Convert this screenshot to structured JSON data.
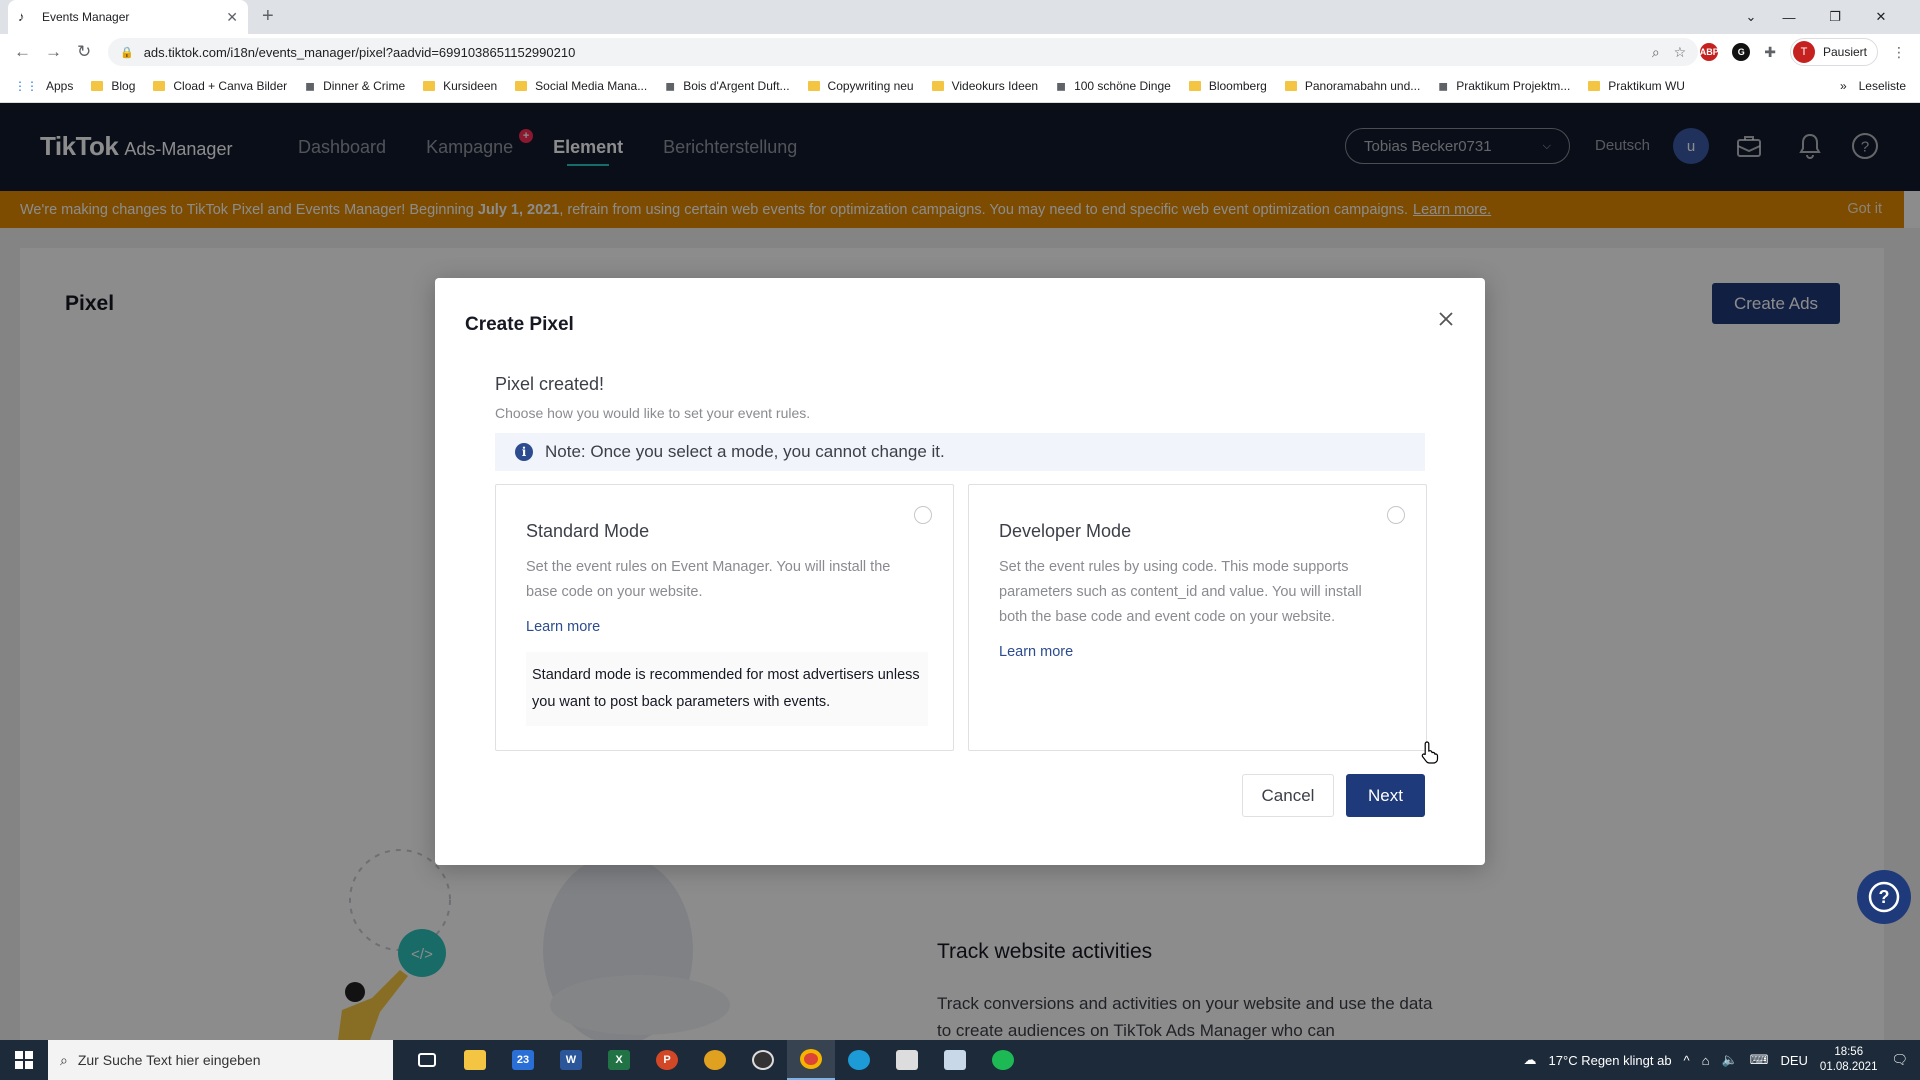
{
  "browser": {
    "tab_title": "Events Manager",
    "url": "ads.tiktok.com/i18n/events_manager/pixel?aadvid=6991038651152990210",
    "profile_status": "Pausiert",
    "profile_initial": "T",
    "bookmarks": [
      {
        "label": "Apps",
        "icon": "apps-icon"
      },
      {
        "label": "Blog",
        "icon": "folder-icon"
      },
      {
        "label": "Cload + Canva Bilder",
        "icon": "folder-icon"
      },
      {
        "label": "Dinner & Crime",
        "icon": "jd-favicon"
      },
      {
        "label": "Kursideen",
        "icon": "folder-icon"
      },
      {
        "label": "Social Media Mana...",
        "icon": "folder-icon"
      },
      {
        "label": "Bois d'Argent Duft...",
        "icon": "site-favicon"
      },
      {
        "label": "Copywriting neu",
        "icon": "folder-icon"
      },
      {
        "label": "Videokurs Ideen",
        "icon": "folder-icon"
      },
      {
        "label": "100 schöne Dinge",
        "icon": "site-favicon"
      },
      {
        "label": "Bloomberg",
        "icon": "folder-icon"
      },
      {
        "label": "Panoramabahn und...",
        "icon": "folder-icon"
      },
      {
        "label": "Praktikum Projektm...",
        "icon": "site-favicon"
      },
      {
        "label": "Praktikum WU",
        "icon": "folder-icon"
      }
    ],
    "reading_list": "Leseliste"
  },
  "header": {
    "logo": "TikTok",
    "logo_sub": "Ads-Manager",
    "nav": [
      {
        "label": "Dashboard",
        "active": false
      },
      {
        "label": "Kampagne",
        "active": false,
        "badge": "+"
      },
      {
        "label": "Element",
        "active": true
      },
      {
        "label": "Berichterstellung",
        "active": false
      }
    ],
    "account": "Tobias Becker0731",
    "language": "Deutsch",
    "user_initial": "u"
  },
  "notice": {
    "text_1": "We're making changes to TikTok Pixel and Events Manager! Beginning ",
    "date": "July 1, 2021",
    "text_2": ", refrain from using certain web events for optimization campaigns. You may need to end specific web event optimization campaigns.",
    "link": "Learn more.",
    "dismiss": "Got it"
  },
  "page": {
    "title": "Pixel",
    "create_ads": "Create Ads",
    "track_title": "Track website activities",
    "track_desc": "Track conversions and activities on your website and use the data to create audiences on TikTok Ads Manager who can"
  },
  "modal": {
    "title": "Create Pixel",
    "heading": "Pixel created!",
    "subheading": "Choose how you would like to set your event rules.",
    "note": "Note: Once you select a mode, you cannot change it.",
    "standard": {
      "name": "Standard Mode",
      "desc": "Set the event rules on Event Manager. You will install the base code on your website.",
      "link": "Learn more",
      "tip": "Standard mode is recommended for most advertisers unless you want to post back parameters with events."
    },
    "developer": {
      "name": "Developer Mode",
      "desc": "Set the event rules by using code. This mode supports parameters such as content_id and value. You will install both the base code and event code on your website.",
      "link": "Learn more"
    },
    "cancel": "Cancel",
    "next": "Next"
  },
  "taskbar": {
    "search_placeholder": "Zur Suche Text hier eingeben",
    "mail_badge": "23",
    "weather": "17°C  Regen klingt ab",
    "lang": "DEU",
    "time": "18:56",
    "date": "01.08.2021"
  },
  "colors": {
    "header_bg": "#121a2d",
    "notice_bg": "#e38a00",
    "primary": "#1f3a7a",
    "accent": "#26c6c0"
  }
}
